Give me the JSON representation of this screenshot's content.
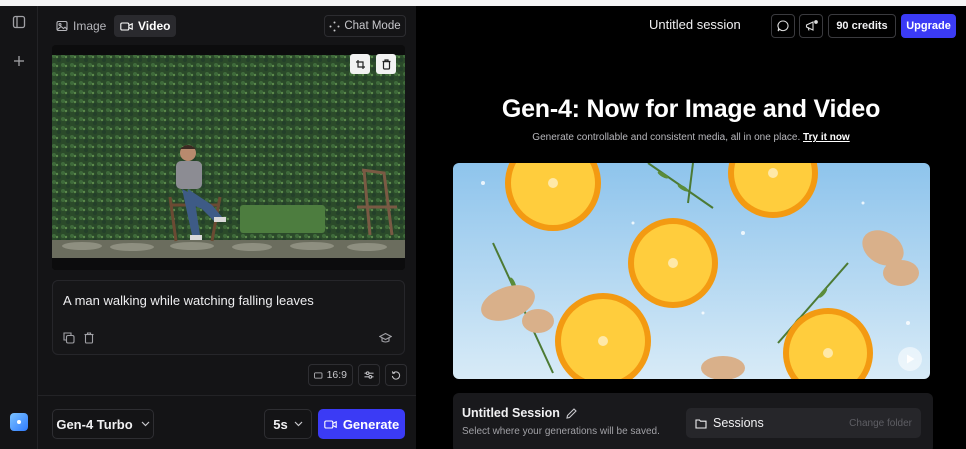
{
  "left_panel": {
    "tabs": [
      {
        "label": "Image",
        "icon": "image-icon"
      },
      {
        "label": "Video",
        "icon": "video-icon",
        "active": true
      }
    ],
    "chat_mode_label": "Chat Mode",
    "prompt_text": "A man walking while watching falling leaves",
    "aspect_ratio_label": "16:9",
    "model_label": "Gen-4 Turbo",
    "duration_label": "5s",
    "generate_label": "Generate"
  },
  "header": {
    "session_title": "Untitled session",
    "credits_label": "90 credits",
    "upgrade_label": "Upgrade"
  },
  "hero": {
    "title": "Gen-4: Now for Image and Video",
    "subtitle": "Generate controllable and consistent media, all in one place.",
    "link_label": "Try it now"
  },
  "session_card": {
    "title": "Untitled Session",
    "description": "Select where your generations will be saved.",
    "folder_label": "Sessions",
    "change_folder_label": "Change folder"
  },
  "colors": {
    "accent": "#3b3bf5",
    "panel_bg": "#141416",
    "main_bg": "#000000"
  }
}
